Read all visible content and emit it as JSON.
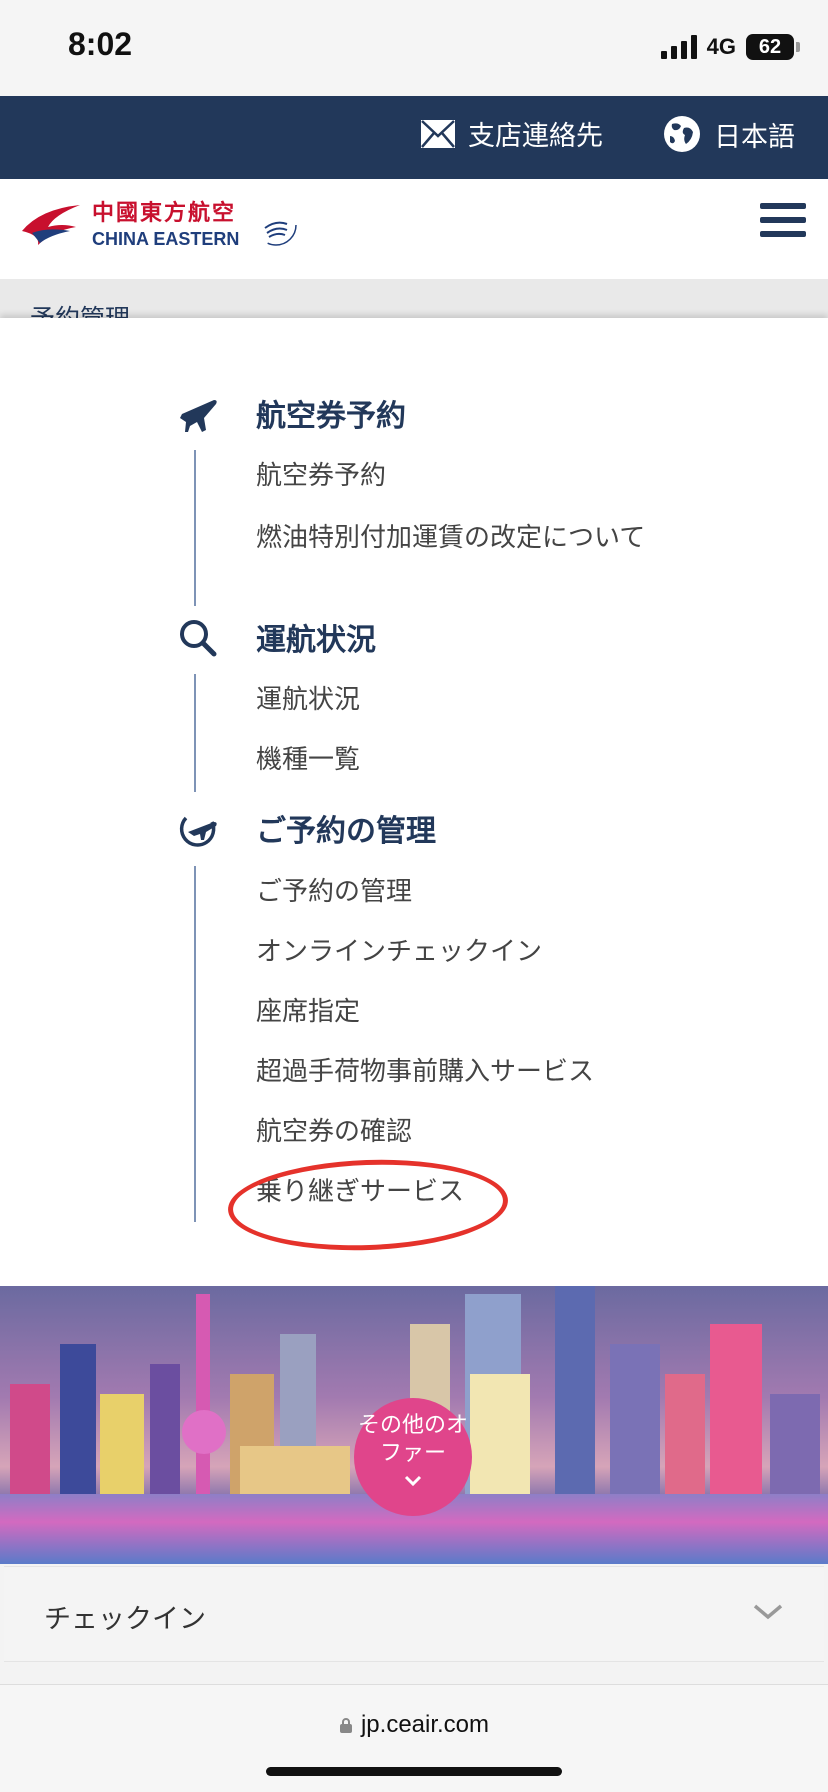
{
  "status_bar": {
    "time": "8:02",
    "network": "4G",
    "battery": "62"
  },
  "util_bar": {
    "contact_label": "支店連絡先",
    "language_label": "日本語"
  },
  "header": {
    "logo_cn": "中國東方航空",
    "logo_en": "CHINA EASTERN",
    "brand_color": "#c8102e",
    "navy": "#22385a"
  },
  "breadcrumb": "予約管理",
  "menu": {
    "sections": [
      {
        "title": "航空券予約",
        "icon": "airplane-icon",
        "items": [
          "航空券予約",
          "燃油特別付加運賃の改定について"
        ]
      },
      {
        "title": "運航状況",
        "icon": "search-icon",
        "items": [
          "運航状況",
          "機種一覧"
        ]
      },
      {
        "title": "ご予約の管理",
        "icon": "plane-circle-icon",
        "items": [
          "ご予約の管理",
          "オンラインチェックイン",
          "座席指定",
          "超過手荷物事前購入サービス",
          "航空券の確認",
          "乗り継ぎサービス"
        ]
      }
    ]
  },
  "promo": {
    "offer_label": "その他のオファー"
  },
  "checkin": {
    "label": "チェックイン"
  },
  "browser": {
    "url": "jp.ceair.com"
  }
}
